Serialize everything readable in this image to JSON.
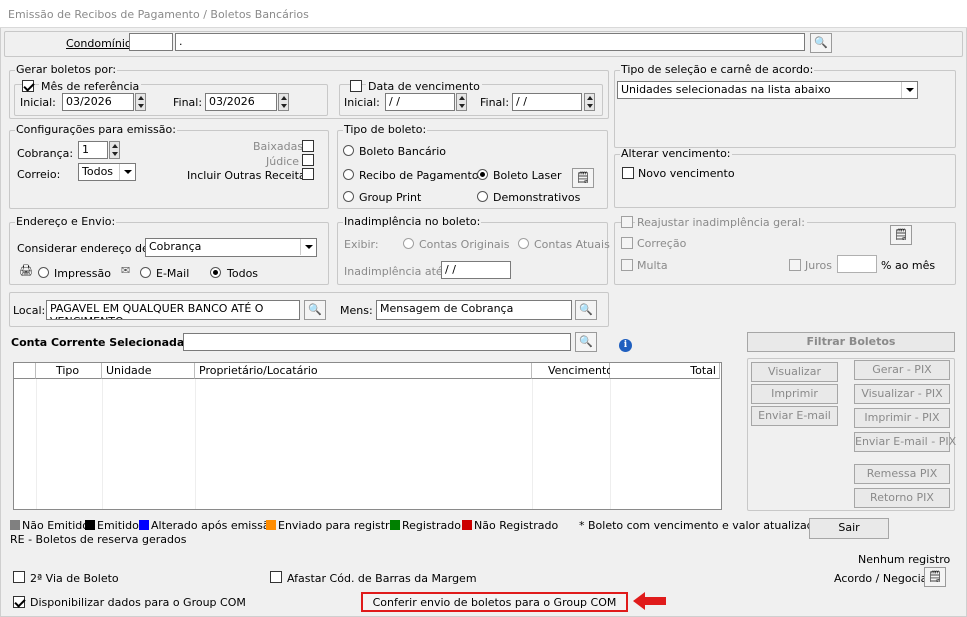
{
  "window": {
    "title": "Emissão de Recibos de Pagamento / Boletos Bancários"
  },
  "condominio": {
    "label": "Condomínio:",
    "code": "",
    "name": "."
  },
  "gerar_boletos": {
    "legend": "Gerar boletos por:",
    "mes_referencia": {
      "label": "Mês de referência",
      "checked": true,
      "inicial_label": "Inicial:",
      "inicial": "03/2026",
      "final_label": "Final:",
      "final": "03/2026"
    },
    "data_vencimento": {
      "label": "Data de vencimento",
      "checked": false,
      "inicial_label": "Inicial:",
      "inicial": " / /",
      "final_label": "Final:",
      "final": " / /"
    }
  },
  "tipo_selecao": {
    "legend": "Tipo de seleção e carnê de acordo:",
    "value": "Unidades selecionadas na lista abaixo"
  },
  "config_emissao": {
    "legend": "Configurações para emissão:",
    "cobranca_label": "Cobrança:",
    "cobranca": "1",
    "correio_label": "Correio:",
    "correio": "Todos",
    "baixadas": "Baixadas",
    "judice": "Júdice",
    "incluir": "Incluir Outras Receitas"
  },
  "tipo_boleto": {
    "legend": "Tipo de boleto:",
    "opcoes": [
      "Boleto Bancário",
      "Recibo de Pagamento",
      "Boleto Laser",
      "Group Print",
      "Demonstrativos"
    ],
    "selecionado": "Boleto Laser"
  },
  "alterar_venc": {
    "legend": "Alterar vencimento:",
    "novo": "Novo vencimento"
  },
  "endereco": {
    "legend": "Endereço e Envio:",
    "considerar_label": "Considerar endereço de:",
    "considerar": "Cobrança",
    "impressao": "Impressão",
    "email": "E-Mail",
    "todos": "Todos"
  },
  "inadimplencia": {
    "legend": "Inadimplência no boleto:",
    "exibir_label": "Exibir:",
    "originais": "Contas Originais",
    "atuais": "Contas Atuais",
    "ate_label": "Inadimplência até:",
    "ate": " / /"
  },
  "reajustar": {
    "label": "Reajustar inadimplência geral:",
    "correcao": "Correção",
    "multa": "Multa",
    "juros": "Juros",
    "ao_mes": "% ao mês"
  },
  "local": {
    "label": "Local:",
    "value": "PAGAVEL EM QUALQUER BANCO ATÉ O VENCIMENTO",
    "mens_label": "Mens:",
    "mens": "Mensagem de Cobrança"
  },
  "conta": {
    "label": "Conta Corrente Selecionada:",
    "value": "",
    "filtrar": "Filtrar Boletos"
  },
  "grid": {
    "columns": [
      "",
      "Tipo",
      "Unidade",
      "Proprietário/Locatário",
      "Vencimento",
      "Total"
    ]
  },
  "actions": {
    "visualizar": "Visualizar",
    "imprimir": "Imprimir",
    "enviar_email": "Enviar E-mail",
    "gerar_pix": "Gerar - PIX",
    "visualizar_pix": "Visualizar - PIX",
    "imprimir_pix": "Imprimir - PIX",
    "enviar_email_pix": "Enviar E-mail - PIX",
    "remessa_pix": "Remessa PIX",
    "retorno_pix": "Retorno PIX"
  },
  "legend_status": [
    {
      "label": "Não Emitido",
      "color": "#808080"
    },
    {
      "label": "Emitido",
      "color": "#000000"
    },
    {
      "label": "Alterado após emissão",
      "color": "#0000ff"
    },
    {
      "label": "Enviado para registro",
      "color": "#ff8c00"
    },
    {
      "label": "Registrado",
      "color": "#008000"
    },
    {
      "label": "Não Registrado",
      "color": "#cc0000"
    }
  ],
  "notes": {
    "atualizado": "* Boleto com vencimento e valor atualizados.",
    "re": "RE - Boletos de reserva gerados",
    "nenhum": "Nenhum registro"
  },
  "footer": {
    "sair": "Sair",
    "segunda_via": "2ª Via de Boleto",
    "afastar": "Afastar Cód. de Barras da Margem",
    "acordo": "Acordo / Negociar",
    "disponibilizar": "Disponibilizar dados para o Group COM",
    "conferir": "Conferir envio de boletos para o Group COM"
  }
}
